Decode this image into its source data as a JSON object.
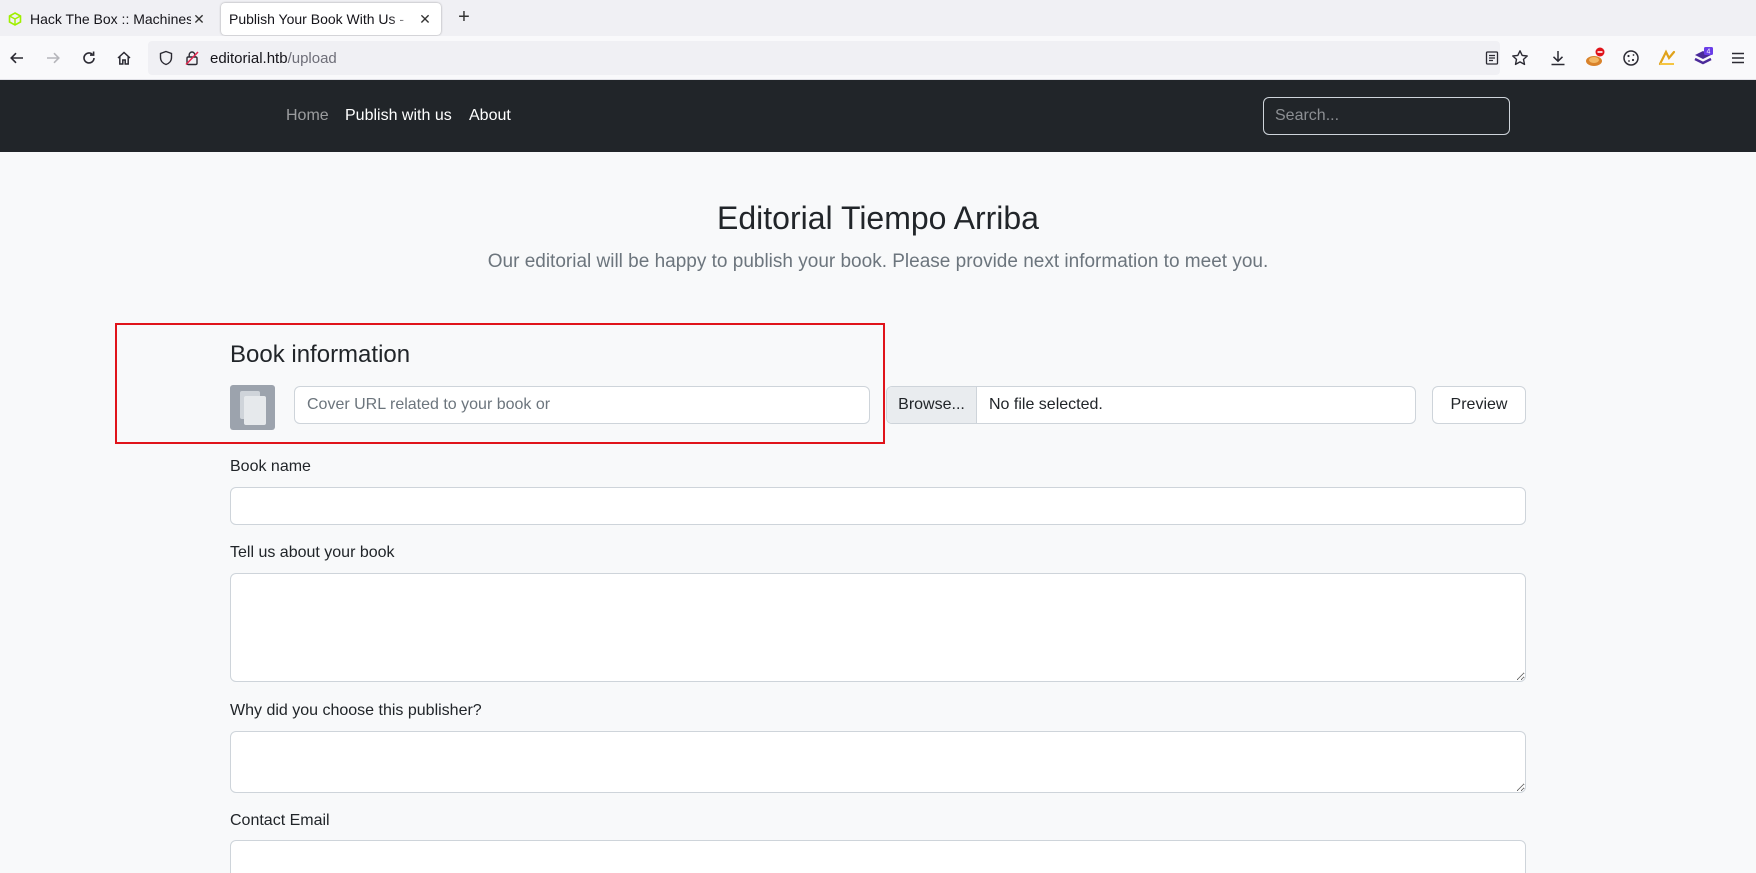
{
  "browser": {
    "tabs": [
      {
        "title": "Hack The Box :: Machines",
        "active": false
      },
      {
        "title": "Publish Your Book With Us -",
        "active": true
      }
    ],
    "url_host": "editorial.htb",
    "url_path": "/upload",
    "extension_badge": "4",
    "accent_colors": {
      "htb_green": "#9fef00",
      "highlight_red": "#e0131a",
      "nav_dark": "#212529"
    }
  },
  "site_nav": {
    "links": [
      {
        "label": "Home",
        "active": false
      },
      {
        "label": "Publish with us",
        "active": true
      },
      {
        "label": "About",
        "active": true
      }
    ],
    "search_placeholder": "Search..."
  },
  "hero": {
    "title": "Editorial Tiempo Arriba",
    "subtitle": "Our editorial will be happy to publish your book. Please provide next information to meet you."
  },
  "form": {
    "section_title": "Book information",
    "cover_url_placeholder": "Cover URL related to your book or",
    "browse_label": "Browse...",
    "file_status": "No file selected.",
    "preview_label": "Preview",
    "book_name_label": "Book name",
    "about_label": "Tell us about your book",
    "why_label": "Why did you choose this publisher?",
    "email_label": "Contact Email"
  }
}
